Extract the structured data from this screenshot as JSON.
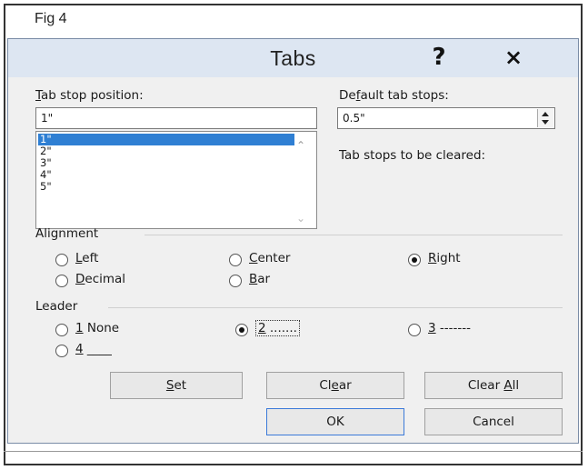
{
  "figure_label": "Fig 4",
  "dialog": {
    "title": "Tabs",
    "help_icon": "?",
    "close_icon": "×"
  },
  "tab_stop": {
    "label_u": "T",
    "label_rest": "ab stop position:",
    "value": "1\"",
    "list": [
      "1\"",
      "2\"",
      "3\"",
      "4\"",
      "5\""
    ],
    "selected_index": 0
  },
  "default_tab_stops": {
    "label_a": "De",
    "label_u": "f",
    "label_b": "ault tab stops:",
    "value": "0.5\""
  },
  "cleared_label": "Tab stops to be cleared:",
  "alignment": {
    "heading": "Alignment",
    "options": [
      {
        "u": "L",
        "rest": "eft",
        "checked": false
      },
      {
        "u": "C",
        "rest": "enter",
        "checked": false
      },
      {
        "u": "R",
        "rest": "ight",
        "checked": true
      },
      {
        "u": "D",
        "rest": "ecimal",
        "checked": false
      },
      {
        "u": "B",
        "rest": "ar",
        "checked": false
      }
    ]
  },
  "leader": {
    "heading": "Leader",
    "options": [
      {
        "u": "1",
        "rest": " None",
        "checked": false
      },
      {
        "u": "2",
        "rest": " .......",
        "checked": true
      },
      {
        "u": "3",
        "rest": " -------",
        "checked": false
      },
      {
        "u": "4",
        "rest": " ____",
        "checked": false
      }
    ]
  },
  "buttons": {
    "set_u": "S",
    "set_rest": "et",
    "clear_a": "Cl",
    "clear_u": "e",
    "clear_b": "ar",
    "clear_all_a": "Clear ",
    "clear_all_u": "A",
    "clear_all_b": "ll",
    "ok": "OK",
    "cancel": "Cancel"
  }
}
